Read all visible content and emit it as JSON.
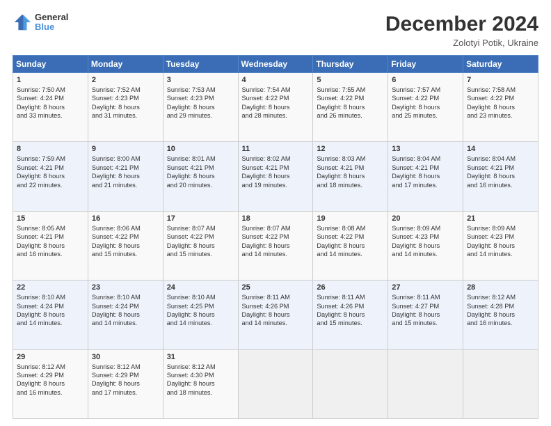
{
  "header": {
    "logo_line1": "General",
    "logo_line2": "Blue",
    "month": "December 2024",
    "location": "Zolotyi Potik, Ukraine"
  },
  "days_of_week": [
    "Sunday",
    "Monday",
    "Tuesday",
    "Wednesday",
    "Thursday",
    "Friday",
    "Saturday"
  ],
  "weeks": [
    [
      {
        "day": "1",
        "lines": [
          "Sunrise: 7:50 AM",
          "Sunset: 4:24 PM",
          "Daylight: 8 hours",
          "and 33 minutes."
        ]
      },
      {
        "day": "2",
        "lines": [
          "Sunrise: 7:52 AM",
          "Sunset: 4:23 PM",
          "Daylight: 8 hours",
          "and 31 minutes."
        ]
      },
      {
        "day": "3",
        "lines": [
          "Sunrise: 7:53 AM",
          "Sunset: 4:23 PM",
          "Daylight: 8 hours",
          "and 29 minutes."
        ]
      },
      {
        "day": "4",
        "lines": [
          "Sunrise: 7:54 AM",
          "Sunset: 4:22 PM",
          "Daylight: 8 hours",
          "and 28 minutes."
        ]
      },
      {
        "day": "5",
        "lines": [
          "Sunrise: 7:55 AM",
          "Sunset: 4:22 PM",
          "Daylight: 8 hours",
          "and 26 minutes."
        ]
      },
      {
        "day": "6",
        "lines": [
          "Sunrise: 7:57 AM",
          "Sunset: 4:22 PM",
          "Daylight: 8 hours",
          "and 25 minutes."
        ]
      },
      {
        "day": "7",
        "lines": [
          "Sunrise: 7:58 AM",
          "Sunset: 4:22 PM",
          "Daylight: 8 hours",
          "and 23 minutes."
        ]
      }
    ],
    [
      {
        "day": "8",
        "lines": [
          "Sunrise: 7:59 AM",
          "Sunset: 4:21 PM",
          "Daylight: 8 hours",
          "and 22 minutes."
        ]
      },
      {
        "day": "9",
        "lines": [
          "Sunrise: 8:00 AM",
          "Sunset: 4:21 PM",
          "Daylight: 8 hours",
          "and 21 minutes."
        ]
      },
      {
        "day": "10",
        "lines": [
          "Sunrise: 8:01 AM",
          "Sunset: 4:21 PM",
          "Daylight: 8 hours",
          "and 20 minutes."
        ]
      },
      {
        "day": "11",
        "lines": [
          "Sunrise: 8:02 AM",
          "Sunset: 4:21 PM",
          "Daylight: 8 hours",
          "and 19 minutes."
        ]
      },
      {
        "day": "12",
        "lines": [
          "Sunrise: 8:03 AM",
          "Sunset: 4:21 PM",
          "Daylight: 8 hours",
          "and 18 minutes."
        ]
      },
      {
        "day": "13",
        "lines": [
          "Sunrise: 8:04 AM",
          "Sunset: 4:21 PM",
          "Daylight: 8 hours",
          "and 17 minutes."
        ]
      },
      {
        "day": "14",
        "lines": [
          "Sunrise: 8:04 AM",
          "Sunset: 4:21 PM",
          "Daylight: 8 hours",
          "and 16 minutes."
        ]
      }
    ],
    [
      {
        "day": "15",
        "lines": [
          "Sunrise: 8:05 AM",
          "Sunset: 4:21 PM",
          "Daylight: 8 hours",
          "and 16 minutes."
        ]
      },
      {
        "day": "16",
        "lines": [
          "Sunrise: 8:06 AM",
          "Sunset: 4:22 PM",
          "Daylight: 8 hours",
          "and 15 minutes."
        ]
      },
      {
        "day": "17",
        "lines": [
          "Sunrise: 8:07 AM",
          "Sunset: 4:22 PM",
          "Daylight: 8 hours",
          "and 15 minutes."
        ]
      },
      {
        "day": "18",
        "lines": [
          "Sunrise: 8:07 AM",
          "Sunset: 4:22 PM",
          "Daylight: 8 hours",
          "and 14 minutes."
        ]
      },
      {
        "day": "19",
        "lines": [
          "Sunrise: 8:08 AM",
          "Sunset: 4:22 PM",
          "Daylight: 8 hours",
          "and 14 minutes."
        ]
      },
      {
        "day": "20",
        "lines": [
          "Sunrise: 8:09 AM",
          "Sunset: 4:23 PM",
          "Daylight: 8 hours",
          "and 14 minutes."
        ]
      },
      {
        "day": "21",
        "lines": [
          "Sunrise: 8:09 AM",
          "Sunset: 4:23 PM",
          "Daylight: 8 hours",
          "and 14 minutes."
        ]
      }
    ],
    [
      {
        "day": "22",
        "lines": [
          "Sunrise: 8:10 AM",
          "Sunset: 4:24 PM",
          "Daylight: 8 hours",
          "and 14 minutes."
        ]
      },
      {
        "day": "23",
        "lines": [
          "Sunrise: 8:10 AM",
          "Sunset: 4:24 PM",
          "Daylight: 8 hours",
          "and 14 minutes."
        ]
      },
      {
        "day": "24",
        "lines": [
          "Sunrise: 8:10 AM",
          "Sunset: 4:25 PM",
          "Daylight: 8 hours",
          "and 14 minutes."
        ]
      },
      {
        "day": "25",
        "lines": [
          "Sunrise: 8:11 AM",
          "Sunset: 4:26 PM",
          "Daylight: 8 hours",
          "and 14 minutes."
        ]
      },
      {
        "day": "26",
        "lines": [
          "Sunrise: 8:11 AM",
          "Sunset: 4:26 PM",
          "Daylight: 8 hours",
          "and 15 minutes."
        ]
      },
      {
        "day": "27",
        "lines": [
          "Sunrise: 8:11 AM",
          "Sunset: 4:27 PM",
          "Daylight: 8 hours",
          "and 15 minutes."
        ]
      },
      {
        "day": "28",
        "lines": [
          "Sunrise: 8:12 AM",
          "Sunset: 4:28 PM",
          "Daylight: 8 hours",
          "and 16 minutes."
        ]
      }
    ],
    [
      {
        "day": "29",
        "lines": [
          "Sunrise: 8:12 AM",
          "Sunset: 4:29 PM",
          "Daylight: 8 hours",
          "and 16 minutes."
        ]
      },
      {
        "day": "30",
        "lines": [
          "Sunrise: 8:12 AM",
          "Sunset: 4:29 PM",
          "Daylight: 8 hours",
          "and 17 minutes."
        ]
      },
      {
        "day": "31",
        "lines": [
          "Sunrise: 8:12 AM",
          "Sunset: 4:30 PM",
          "Daylight: 8 hours",
          "and 18 minutes."
        ]
      },
      null,
      null,
      null,
      null
    ]
  ]
}
